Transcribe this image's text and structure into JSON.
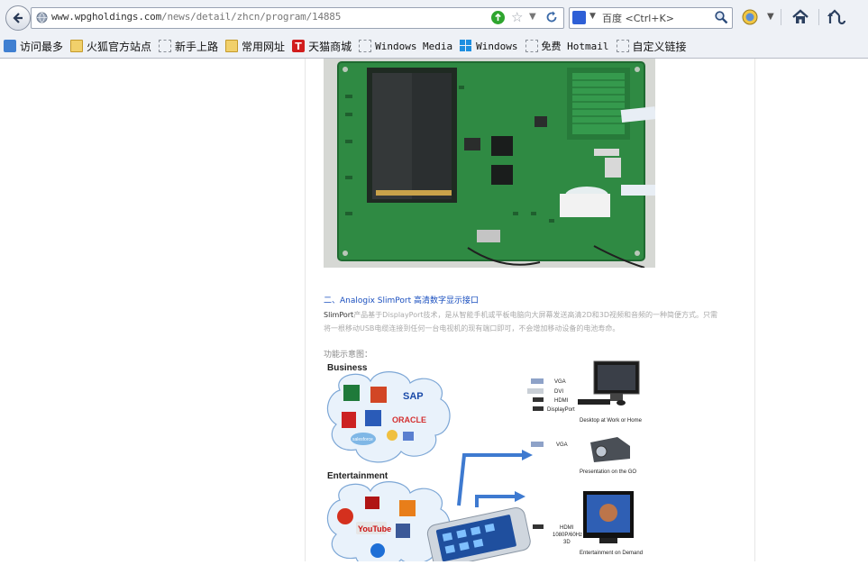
{
  "toolbar": {
    "url_host": "www.wpgholdings.com",
    "url_path": "/news/detail/zhcn/program/14885",
    "search_placeholder": "百度 <Ctrl+K>"
  },
  "bookmarks": [
    {
      "label": "访问最多",
      "icon": "most-visited-icon"
    },
    {
      "label": "火狐官方站点",
      "icon": "folder-icon"
    },
    {
      "label": "新手上路",
      "icon": "page-icon"
    },
    {
      "label": "常用网址",
      "icon": "folder-icon"
    },
    {
      "label": "天猫商城",
      "icon": "tmall-icon"
    },
    {
      "label": "Windows Media",
      "icon": "page-icon"
    },
    {
      "label": "Windows",
      "icon": "windows-icon"
    },
    {
      "label": "免费 Hotmail",
      "icon": "page-icon"
    },
    {
      "label": "自定义链接",
      "icon": "page-icon"
    }
  ],
  "article": {
    "heading": "二、Analogix SlimPort 高清数字显示接口",
    "paragraph_lead": "SlimPort",
    "paragraph_body": "产品基于DisplayPort技术，是从智能手机或平板电脑向大屏幕发送高清2D和3D视频和音频的一种简便方式。只需将一根移动USB电缆连接到任何一台电视机的现有端口即可，不会增加移动设备的电池寿命。",
    "diagram_title": "功能示意图：",
    "diagram": {
      "business_label": "Business",
      "entertainment_label": "Entertainment",
      "oracle_label": "ORACLE",
      "sap_label": "SAP",
      "youtube_label": "YouTube",
      "salesforce_label": "salesforce",
      "tmall_letter": "T",
      "ports1": [
        "VGA",
        "DVI",
        "HDMI",
        "DisplayPort"
      ],
      "caption1": "Desktop at Work or Home",
      "port2": "VGA",
      "caption2": "Presentation on the GO",
      "port3_lines": [
        "HDMI",
        "1080P/60Hz",
        "3D"
      ],
      "caption3": "Entertainment on Demand"
    }
  }
}
